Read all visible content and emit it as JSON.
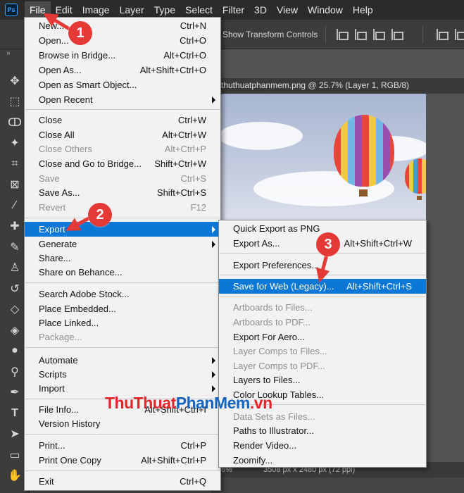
{
  "menubar": {
    "logo": "Ps",
    "items": [
      "File",
      "Edit",
      "Image",
      "Layer",
      "Type",
      "Select",
      "Filter",
      "3D",
      "View",
      "Window",
      "Help"
    ]
  },
  "options": {
    "show_transform": "Show Transform Controls"
  },
  "toolbar": {
    "collapse": "»"
  },
  "document": {
    "tab_title": "thuthuatphanmem.png @ 25.7% (Layer 1, RGB/8)",
    "status_zoom": "6%",
    "status_size": "3508 px x 2480 px (72 ppi)"
  },
  "file_menu": {
    "items": [
      {
        "label": "New...",
        "shortcut": "Ctrl+N"
      },
      {
        "label": "Open...",
        "shortcut": "Ctrl+O"
      },
      {
        "label": "Browse in Bridge...",
        "shortcut": "Alt+Ctrl+O"
      },
      {
        "label": "Open As...",
        "shortcut": "Alt+Shift+Ctrl+O"
      },
      {
        "label": "Open as Smart Object...",
        "shortcut": ""
      },
      {
        "label": "Open Recent",
        "shortcut": ""
      },
      {
        "label": "Close",
        "shortcut": "Ctrl+W"
      },
      {
        "label": "Close All",
        "shortcut": "Alt+Ctrl+W"
      },
      {
        "label": "Close Others",
        "shortcut": "Alt+Ctrl+P"
      },
      {
        "label": "Close and Go to Bridge...",
        "shortcut": "Shift+Ctrl+W"
      },
      {
        "label": "Save",
        "shortcut": "Ctrl+S"
      },
      {
        "label": "Save As...",
        "shortcut": "Shift+Ctrl+S"
      },
      {
        "label": "Revert",
        "shortcut": "F12"
      },
      {
        "label": "Export",
        "shortcut": ""
      },
      {
        "label": "Generate",
        "shortcut": ""
      },
      {
        "label": "Share...",
        "shortcut": ""
      },
      {
        "label": "Share on Behance...",
        "shortcut": ""
      },
      {
        "label": "Search Adobe Stock...",
        "shortcut": ""
      },
      {
        "label": "Place Embedded...",
        "shortcut": ""
      },
      {
        "label": "Place Linked...",
        "shortcut": ""
      },
      {
        "label": "Package...",
        "shortcut": ""
      },
      {
        "label": "Automate",
        "shortcut": ""
      },
      {
        "label": "Scripts",
        "shortcut": ""
      },
      {
        "label": "Import",
        "shortcut": ""
      },
      {
        "label": "File Info...",
        "shortcut": "Alt+Shift+Ctrl+I"
      },
      {
        "label": "Version History",
        "shortcut": ""
      },
      {
        "label": "Print...",
        "shortcut": "Ctrl+P"
      },
      {
        "label": "Print One Copy",
        "shortcut": "Alt+Shift+Ctrl+P"
      },
      {
        "label": "Exit",
        "shortcut": "Ctrl+Q"
      }
    ]
  },
  "export_menu": {
    "items": [
      {
        "label": "Quick Export as PNG",
        "shortcut": ""
      },
      {
        "label": "Export As...",
        "shortcut": "Alt+Shift+Ctrl+W"
      },
      {
        "label": "Export Preferences...",
        "shortcut": ""
      },
      {
        "label": "Save for Web (Legacy)...",
        "shortcut": "Alt+Shift+Ctrl+S"
      },
      {
        "label": "Artboards to Files...",
        "shortcut": ""
      },
      {
        "label": "Artboards to PDF...",
        "shortcut": ""
      },
      {
        "label": "Export For Aero...",
        "shortcut": ""
      },
      {
        "label": "Layer Comps to Files...",
        "shortcut": ""
      },
      {
        "label": "Layer Comps to PDF...",
        "shortcut": ""
      },
      {
        "label": "Layers to Files...",
        "shortcut": ""
      },
      {
        "label": "Color Lookup Tables...",
        "shortcut": ""
      },
      {
        "label": "Data Sets as Files...",
        "shortcut": ""
      },
      {
        "label": "Paths to Illustrator...",
        "shortcut": ""
      },
      {
        "label": "Render Video...",
        "shortcut": ""
      },
      {
        "label": "Zoomify...",
        "shortcut": ""
      }
    ]
  },
  "callouts": [
    "1",
    "2",
    "3"
  ],
  "watermark": {
    "part1": "ThuThuat",
    "part2": "PhanMem",
    "part3": ".vn"
  },
  "colors": {
    "highlight": "#0b78d7",
    "callout": "#e53935",
    "watermark_red": "#e3262b",
    "watermark_blue": "#1565c0"
  }
}
